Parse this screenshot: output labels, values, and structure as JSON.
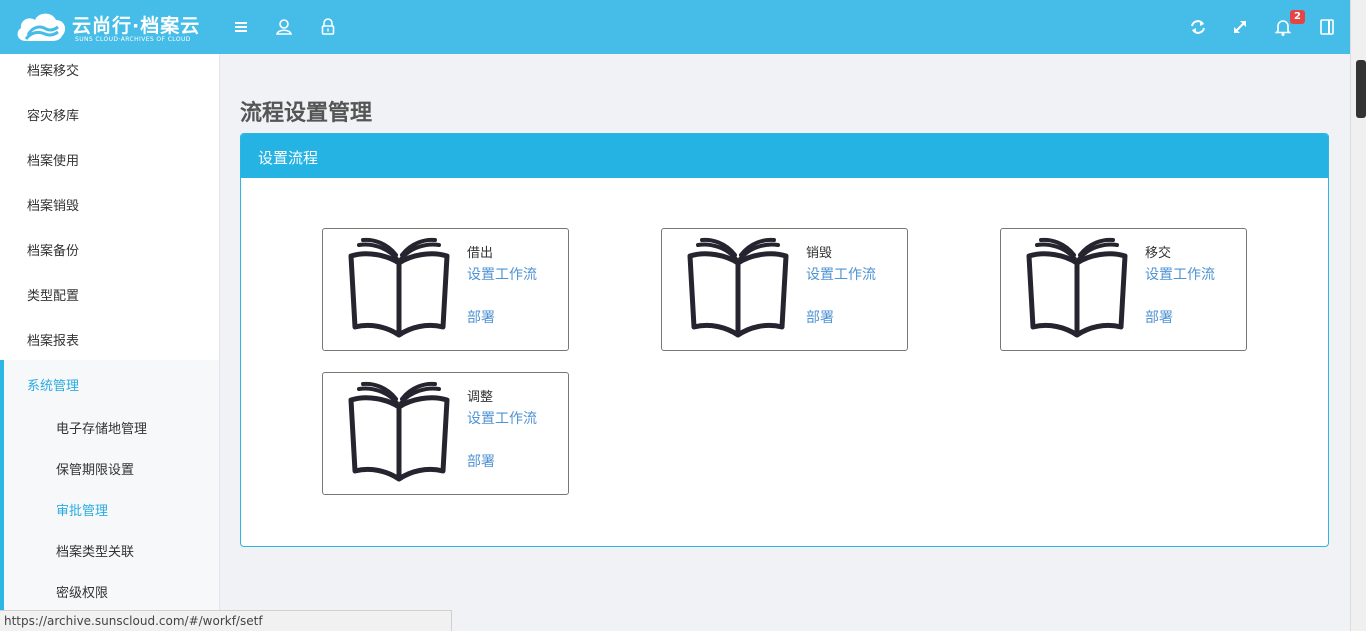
{
  "header": {
    "logo_title": "云尚行·档案云",
    "logo_subtitle": "SUNS CLOUD·ARCHIVES OF CLOUD",
    "notification_count": "2",
    "accent_color": "#45bde8"
  },
  "sidebar": {
    "items": [
      {
        "label": "档案移交"
      },
      {
        "label": "容灾移库"
      },
      {
        "label": "档案使用"
      },
      {
        "label": "档案销毁"
      },
      {
        "label": "档案备份"
      },
      {
        "label": "类型配置"
      },
      {
        "label": "档案报表"
      },
      {
        "label": "系统管理"
      }
    ],
    "sub_items": [
      {
        "label": "电子存储地管理"
      },
      {
        "label": "保管期限设置"
      },
      {
        "label": "审批管理"
      },
      {
        "label": "档案类型关联"
      },
      {
        "label": "密级权限"
      }
    ]
  },
  "main": {
    "page_title": "流程设置管理",
    "panel_title": "设置流程",
    "cards": [
      {
        "name": "借出",
        "set_label": "设置工作流",
        "deploy_label": "部署"
      },
      {
        "name": "销毁",
        "set_label": "设置工作流",
        "deploy_label": "部署"
      },
      {
        "name": "移交",
        "set_label": "设置工作流",
        "deploy_label": "部署"
      },
      {
        "name": "调整",
        "set_label": "设置工作流",
        "deploy_label": "部署"
      }
    ]
  },
  "statusbar": {
    "url": "https://archive.sunscloud.com/#/workf/setf"
  }
}
